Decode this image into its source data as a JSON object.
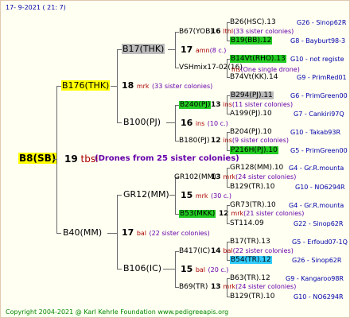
{
  "date": "17-  9-2021 (  21:  7)",
  "root": {
    "label": "B8(SB)",
    "num": "19",
    "ins": "tbsl",
    "drone": "(Drones from 25 sister colonies)"
  },
  "g1": [
    {
      "label": "B176(THK)",
      "num": "18",
      "ins": "mrk",
      "sis": "(33 sister colonies)"
    },
    {
      "label": "B40(MM)",
      "num": "17",
      "ins": "bal",
      "sis": "(22 sister colonies)"
    }
  ],
  "g2": [
    {
      "label": "B17(THK)",
      "num": "17",
      "ins": "amn",
      "sis": "(8 c.)"
    },
    {
      "label": "B100(PJ)",
      "num": "16",
      "ins": "ins",
      "sis": "(10 c.)"
    },
    {
      "label": "GR12(MM)",
      "num": "15",
      "ins": "mrk",
      "sis": "(30 c.)"
    },
    {
      "label": "B106(IC)",
      "num": "15",
      "ins": "bal",
      "sis": "(20 c.)"
    }
  ],
  "g3": [
    {
      "label": "B67(YOB)",
      "num": "16",
      "ins": "lthl",
      "sis": "(33 sister colonies)"
    },
    {
      "label": "VSHmix17-02(16)",
      "num": "",
      "ins": "ins",
      "sis": "(One single drone)"
    },
    {
      "label": "B240(PJ)",
      "num": "13",
      "ins": "ins",
      "sis": "(11 sister colonies)"
    },
    {
      "label": "B180(PJ)",
      "num": "12",
      "ins": "ins",
      "sis": "(9 sister colonies)"
    },
    {
      "label": "GR102(MM)",
      "num": "13",
      "ins": "mrk",
      "sis": "(24 sister colonies)"
    },
    {
      "label": "B53(MKK)",
      "num": "12",
      "ins": "mrk",
      "sis": "(21 sister colonies)"
    },
    {
      "label": "B417(IC)",
      "num": "14",
      "ins": "bal",
      "sis": "(22 sister colonies)"
    },
    {
      "label": "B69(TR)",
      "num": "13",
      "ins": "mrk",
      "sis": "(24 sister colonies)"
    }
  ],
  "g4": [
    {
      "label": "B26(HSC).13",
      "ref": "G26 - Sinop62R"
    },
    {
      "label": "B19(BB).12",
      "ref": "G8 - Bayburt98-3"
    },
    {
      "label": "B14Vt(RHO).13",
      "ref": "G10 - not registe"
    },
    {
      "label": "B74Vt(KK).14",
      "ref": "G9 - PrimRed01"
    },
    {
      "label": "B294(PJ).11",
      "ref": "G6 - PrimGreen00"
    },
    {
      "label": "A199(PJ).10",
      "ref": "G7 - Cankiri97Q"
    },
    {
      "label": "B204(PJ).10",
      "ref": "G10 - Takab93R"
    },
    {
      "label": "P216H(PJ).10",
      "ref": "G5 - PrimGreen00"
    },
    {
      "label": "GR128(MM).10",
      "ref": "G4 - Gr.R.mounta"
    },
    {
      "label": "B129(TR).10",
      "ref": "G10 - NO6294R"
    },
    {
      "label": "GR73(TR).10",
      "ref": "G4 - Gr.R.mounta"
    },
    {
      "label": "ST114.09",
      "ref": "G22 - Sinop62R"
    },
    {
      "label": "B17(TR).13",
      "ref": "G5 - Erfoud07-1Q"
    },
    {
      "label": "B54(TR).12",
      "ref": "G26 - Sinop62R"
    },
    {
      "label": "B63(TR).12",
      "ref": "G9 - Kangaroo98R"
    },
    {
      "label": "B129(TR).10",
      "ref": "G10 - NO6294R"
    }
  ],
  "footer": "Copyright 2004-2021 @ Karl Kehrle Foundation    www.pedigreeapis.org"
}
